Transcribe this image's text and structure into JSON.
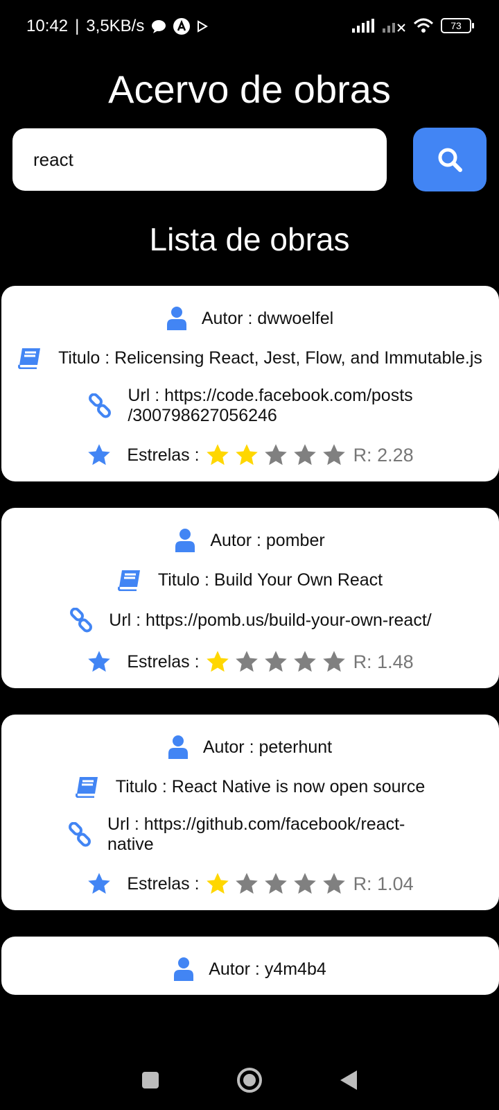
{
  "status_bar": {
    "time": "10:42",
    "speed": "3,5KB/s",
    "battery": "73"
  },
  "header": {
    "title": "Acervo de obras"
  },
  "search": {
    "value": "react",
    "placeholder": ""
  },
  "list_title": "Lista de obras",
  "labels": {
    "autor": "Autor : ",
    "titulo": "Titulo : ",
    "url": "Url : ",
    "estrelas": "Estrelas :"
  },
  "icons": {
    "author": "user-icon",
    "title": "book-icon",
    "url": "link-icon",
    "stars": "star-icon",
    "search": "search-icon"
  },
  "colors": {
    "accent": "#4285f4",
    "star_filled": "#ffd700",
    "star_empty": "#808080"
  },
  "works": [
    {
      "author": "dwwoelfel",
      "title": "Relicensing React, Jest, Flow, and Immutable.js",
      "url_line1": "https://code.facebook.com/posts",
      "url_line2": "/300798627056246",
      "filled_stars": 2,
      "rating": "R: 2.28"
    },
    {
      "author": "pomber",
      "title": "Build Your Own React",
      "url_line1": "https://pomb.us/build-your-own-react/",
      "url_line2": "",
      "filled_stars": 1,
      "rating": "R: 1.48"
    },
    {
      "author": "peterhunt",
      "title": "React Native is now open source",
      "url_line1": "https://github.com/facebook/react-native",
      "url_line2": "",
      "filled_stars": 1,
      "rating": "R: 1.04"
    },
    {
      "author": "y4m4b4",
      "title": "",
      "url_line1": "",
      "url_line2": "",
      "filled_stars": 0,
      "rating": ""
    }
  ]
}
